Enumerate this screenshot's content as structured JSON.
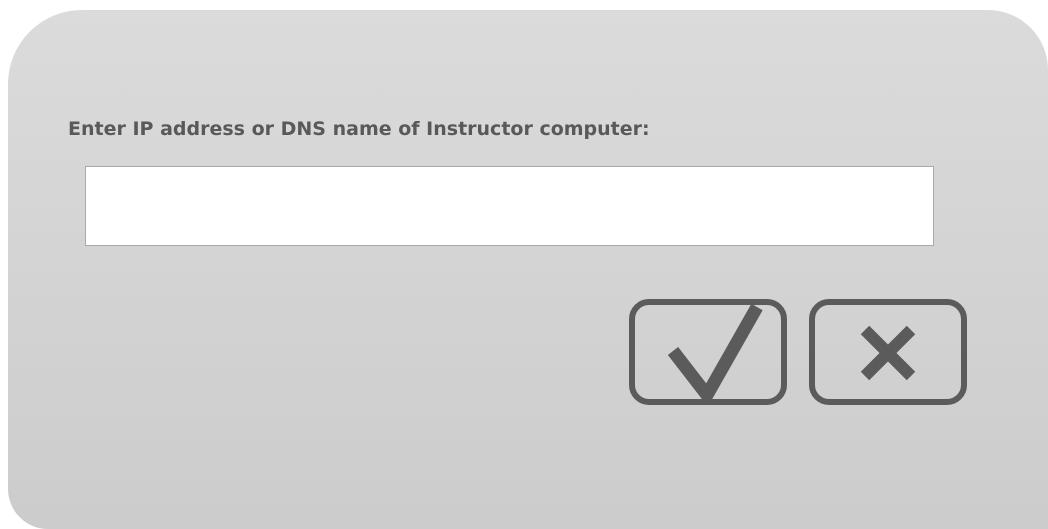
{
  "dialog": {
    "prompt": "Enter IP address or DNS name of Instructor computer:",
    "host_value": "",
    "host_placeholder": ""
  },
  "buttons": {
    "ok_icon": "checkmark-icon",
    "cancel_icon": "close-icon"
  },
  "colors": {
    "panel_top": "#dbdbdb",
    "panel_bottom": "#cccccc",
    "label_text": "#595959",
    "icon_stroke": "#5b5b5b",
    "input_border": "#a9a9a9"
  }
}
